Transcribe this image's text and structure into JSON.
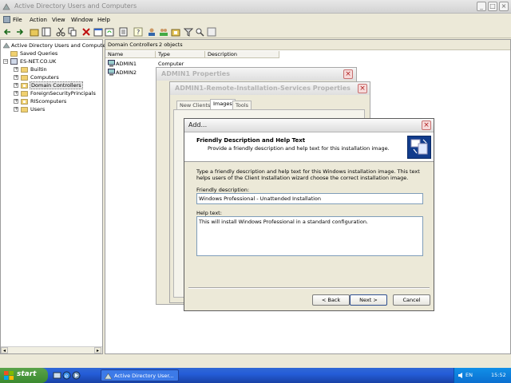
{
  "window": {
    "title": "Active Directory Users and Computers"
  },
  "menu": {
    "items": [
      "File",
      "Action",
      "View",
      "Window",
      "Help"
    ]
  },
  "tree": {
    "root": "Active Directory Users and Computers",
    "nodes": [
      {
        "label": "Saved Queries"
      },
      {
        "label": "ES-NET.CO.UK"
      },
      {
        "label": "Builtin"
      },
      {
        "label": "Computers"
      },
      {
        "label": "Domain Controllers"
      },
      {
        "label": "ForeignSecurityPrincipals"
      },
      {
        "label": "RIScomputers"
      },
      {
        "label": "Users"
      }
    ]
  },
  "pane": {
    "title": "Domain Controllers",
    "count": "2 objects",
    "columns": [
      "Name",
      "Type",
      "Description"
    ],
    "rows": [
      {
        "name": "ADMIN1",
        "type": "Computer"
      },
      {
        "name": "ADMIN2"
      }
    ]
  },
  "dialogs": {
    "props_title": "ADMIN1 Properties",
    "ris_title": "ADMIN1-Remote-Installation-Services Properties",
    "tabs": [
      "New Clients",
      "Images",
      "Tools"
    ]
  },
  "add": {
    "title": "Add...",
    "header_title": "Friendly Description and Help Text",
    "header_sub": "Provide a friendly description and help text for this installation image.",
    "body": "Type a friendly description and help text for this Windows installation image. This text helps users of the Client Installation wizard choose the correct installation image.",
    "desc_label": "Friendly description:",
    "desc_value": "Windows Professional - Unattended Installation",
    "help_label": "Help text:",
    "help_value": "This will install Windows Professional in a standard configuration.",
    "back": "< Back",
    "next": "Next >",
    "cancel": "Cancel"
  },
  "taskbar": {
    "start": "start",
    "task": "Active Directory User...",
    "lang": "EN",
    "clock": "15:52"
  },
  "colors": {
    "taskbar": "#245dd8",
    "start": "#3b8a2f",
    "close": "#b02020"
  }
}
